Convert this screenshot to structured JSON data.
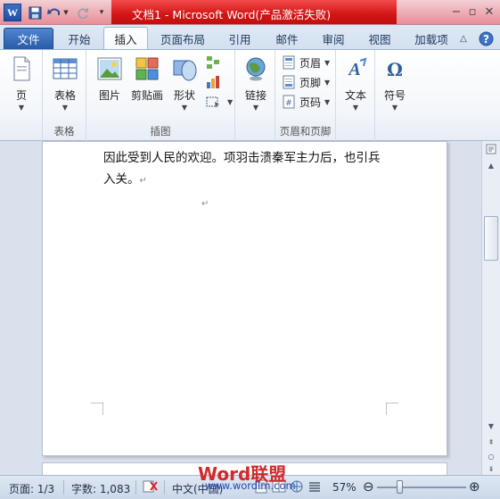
{
  "window": {
    "title": "文档1 - Microsoft Word(产品激活失败)",
    "app_icon": "W"
  },
  "tabs": [
    {
      "label": "文件",
      "state": "file"
    },
    {
      "label": "开始",
      "state": "normal"
    },
    {
      "label": "插入",
      "state": "active"
    },
    {
      "label": "页面布局",
      "state": "normal"
    },
    {
      "label": "引用",
      "state": "normal"
    },
    {
      "label": "邮件",
      "state": "normal"
    },
    {
      "label": "审阅",
      "state": "normal"
    },
    {
      "label": "视图",
      "state": "normal"
    },
    {
      "label": "加载项",
      "state": "normal"
    }
  ],
  "ribbon": {
    "page": {
      "label": "页"
    },
    "table": {
      "label": "表格",
      "group": "表格"
    },
    "illustrations": {
      "picture": "图片",
      "clipart": "剪贴画",
      "shapes": "形状",
      "group": "插图"
    },
    "links": {
      "label": "链接"
    },
    "header_footer": {
      "header": "页眉",
      "footer": "页脚",
      "page_number": "页码",
      "group": "页眉和页脚"
    },
    "text": {
      "label": "文本"
    },
    "symbols": {
      "label": "符号"
    }
  },
  "document": {
    "line1": "因此受到人民的欢迎。项羽击溃秦军主力后，也引兵",
    "line2": "入关。",
    "para_mark": "↵"
  },
  "status": {
    "page": "页面: 1/3",
    "words": "字数: 1,083",
    "language": "中文(中国)",
    "zoom": "57%",
    "zoom_level": 0.57
  },
  "watermark": {
    "brand": "Word联盟",
    "url": "www.wordlm.com"
  },
  "colors": {
    "title_red": "#d21515",
    "file_tab_blue": "#2a5aa6",
    "watermark_red": "#d4282a",
    "watermark_blue": "#1f47b0"
  }
}
